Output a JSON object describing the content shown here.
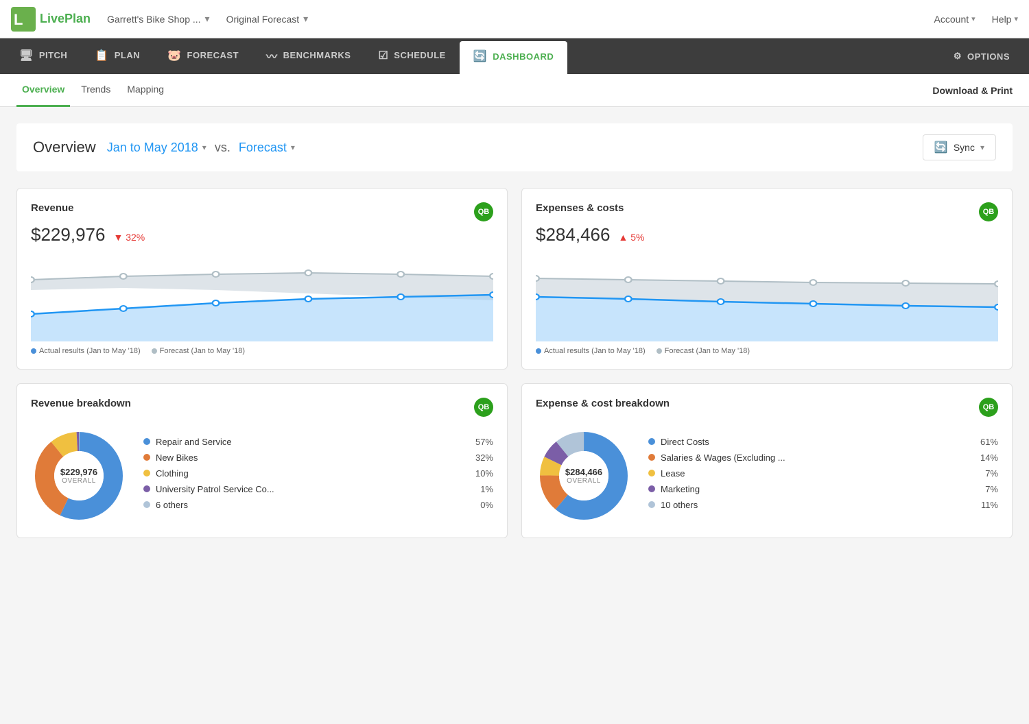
{
  "logo": {
    "text": "LivePlan"
  },
  "topnav": {
    "company": "Garrett's Bike Shop ...",
    "company_chevron": "▾",
    "forecast": "Original Forecast",
    "forecast_chevron": "▾",
    "account": "Account",
    "account_chevron": "▾",
    "help": "Help",
    "help_chevron": "▾"
  },
  "mainnav": {
    "items": [
      {
        "id": "pitch",
        "label": "PITCH",
        "icon": "🖥"
      },
      {
        "id": "plan",
        "label": "PLAN",
        "icon": "📋"
      },
      {
        "id": "forecast",
        "label": "FORECAST",
        "icon": "🐷"
      },
      {
        "id": "benchmarks",
        "label": "BENCHMARKS",
        "icon": "📈"
      },
      {
        "id": "schedule",
        "label": "SCHEDULE",
        "icon": "☑"
      },
      {
        "id": "dashboard",
        "label": "DASHBOARD",
        "icon": "🔄",
        "active": true
      },
      {
        "id": "options",
        "label": "OPTIONS",
        "icon": "⚙"
      }
    ]
  },
  "subnav": {
    "items": [
      {
        "id": "overview",
        "label": "Overview",
        "active": true
      },
      {
        "id": "trends",
        "label": "Trends"
      },
      {
        "id": "mapping",
        "label": "Mapping"
      }
    ],
    "download_print": "Download & Print"
  },
  "overview": {
    "title": "Overview",
    "date_range": "Jan to May 2018",
    "vs": "vs.",
    "comparison": "Forecast",
    "sync_label": "Sync"
  },
  "revenue_card": {
    "title": "Revenue",
    "amount": "$229,976",
    "change": "32%",
    "change_direction": "down",
    "legend_actual": "Actual results (Jan to May '18)",
    "legend_forecast": "Forecast (Jan to May '18)"
  },
  "expenses_card": {
    "title": "Expenses & costs",
    "amount": "$284,466",
    "change": "5%",
    "change_direction": "up",
    "legend_actual": "Actual results (Jan to May '18)",
    "legend_forecast": "Forecast (Jan to May '18)"
  },
  "revenue_breakdown": {
    "title": "Revenue breakdown",
    "total": "$229,976",
    "total_label": "OVERALL",
    "items": [
      {
        "label": "Repair and Service",
        "pct": "57%",
        "color": "#4a90d9"
      },
      {
        "label": "New Bikes",
        "pct": "32%",
        "color": "#e07b39"
      },
      {
        "label": "Clothing",
        "pct": "10%",
        "color": "#f0c040"
      },
      {
        "label": "University Patrol Service Co...",
        "pct": "1%",
        "color": "#7b5ea7"
      },
      {
        "label": "6 others",
        "pct": "0%",
        "color": "#b0c4d8"
      }
    ]
  },
  "expense_breakdown": {
    "title": "Expense & cost breakdown",
    "total": "$284,466",
    "total_label": "OVERALL",
    "items": [
      {
        "label": "Direct Costs",
        "pct": "61%",
        "color": "#4a90d9"
      },
      {
        "label": "Salaries & Wages (Excluding ...",
        "pct": "14%",
        "color": "#e07b39"
      },
      {
        "label": "Lease",
        "pct": "7%",
        "color": "#f0c040"
      },
      {
        "label": "Marketing",
        "pct": "7%",
        "color": "#7b5ea7"
      },
      {
        "label": "10 others",
        "pct": "11%",
        "color": "#b0c4d8"
      }
    ]
  }
}
